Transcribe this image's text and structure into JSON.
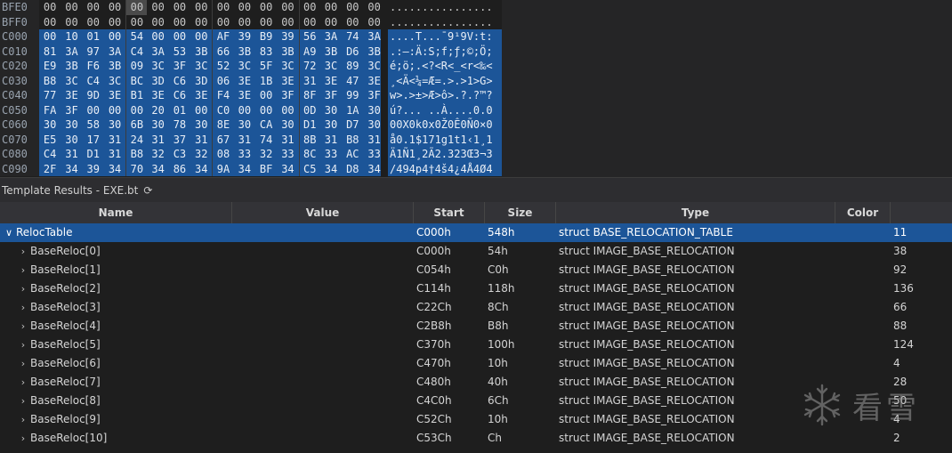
{
  "hex": {
    "rows": [
      {
        "addr": "BFE0",
        "bytes": [
          "00",
          "00",
          "00",
          "00",
          "00",
          "00",
          "00",
          "00",
          "00",
          "00",
          "00",
          "00",
          "00",
          "00",
          "00",
          "00"
        ],
        "ascii": "................",
        "selected": false,
        "cursor": 4
      },
      {
        "addr": "BFF0",
        "bytes": [
          "00",
          "00",
          "00",
          "00",
          "00",
          "00",
          "00",
          "00",
          "00",
          "00",
          "00",
          "00",
          "00",
          "00",
          "00",
          "00"
        ],
        "ascii": "................",
        "selected": false,
        "cursor": -1
      },
      {
        "addr": "C000",
        "bytes": [
          "00",
          "10",
          "01",
          "00",
          "54",
          "00",
          "00",
          "00",
          "AF",
          "39",
          "B9",
          "39",
          "56",
          "3A",
          "74",
          "3A"
        ],
        "ascii": "....T...¯9¹9V:t:",
        "selected": true,
        "cursor": -1
      },
      {
        "addr": "C010",
        "bytes": [
          "81",
          "3A",
          "97",
          "3A",
          "C4",
          "3A",
          "53",
          "3B",
          "66",
          "3B",
          "83",
          "3B",
          "A9",
          "3B",
          "D6",
          "3B"
        ],
        "ascii": ".:—:Ä:S;f;ƒ;©;Ö;",
        "selected": true,
        "cursor": -1
      },
      {
        "addr": "C020",
        "bytes": [
          "E9",
          "3B",
          "F6",
          "3B",
          "09",
          "3C",
          "3F",
          "3C",
          "52",
          "3C",
          "5F",
          "3C",
          "72",
          "3C",
          "89",
          "3C"
        ],
        "ascii": "é;ö;.<?<R<_<r<‰<",
        "selected": true,
        "cursor": -1
      },
      {
        "addr": "C030",
        "bytes": [
          "B8",
          "3C",
          "C4",
          "3C",
          "BC",
          "3D",
          "C6",
          "3D",
          "06",
          "3E",
          "1B",
          "3E",
          "31",
          "3E",
          "47",
          "3E"
        ],
        "ascii": "¸<Ä<¼=Æ=.>.>1>G>",
        "selected": true,
        "cursor": -1
      },
      {
        "addr": "C040",
        "bytes": [
          "77",
          "3E",
          "9D",
          "3E",
          "B1",
          "3E",
          "C6",
          "3E",
          "F4",
          "3E",
          "00",
          "3F",
          "8F",
          "3F",
          "99",
          "3F"
        ],
        "ascii": "w>.>±>Æ>ô>.?.?™?",
        "selected": true,
        "cursor": -1
      },
      {
        "addr": "C050",
        "bytes": [
          "FA",
          "3F",
          "00",
          "00",
          "00",
          "20",
          "01",
          "00",
          "C0",
          "00",
          "00",
          "00",
          "0D",
          "30",
          "1A",
          "30"
        ],
        "ascii": "ú?... ..À....0.0",
        "selected": true,
        "cursor": -1
      },
      {
        "addr": "C060",
        "bytes": [
          "30",
          "30",
          "58",
          "30",
          "6B",
          "30",
          "78",
          "30",
          "8E",
          "30",
          "CA",
          "30",
          "D1",
          "30",
          "D7",
          "30"
        ],
        "ascii": "00X0k0x0Ž0Ê0Ñ0×0",
        "selected": true,
        "cursor": -1
      },
      {
        "addr": "C070",
        "bytes": [
          "E5",
          "30",
          "17",
          "31",
          "24",
          "31",
          "37",
          "31",
          "67",
          "31",
          "74",
          "31",
          "8B",
          "31",
          "B8",
          "31"
        ],
        "ascii": "å0.1$171g1t1‹1¸1",
        "selected": true,
        "cursor": -1
      },
      {
        "addr": "C080",
        "bytes": [
          "C4",
          "31",
          "D1",
          "31",
          "B8",
          "32",
          "C3",
          "32",
          "08",
          "33",
          "32",
          "33",
          "8C",
          "33",
          "AC",
          "33"
        ],
        "ascii": "Ä1Ñ1¸2Ã2.323Œ3¬3",
        "selected": true,
        "cursor": -1
      },
      {
        "addr": "C090",
        "bytes": [
          "2F",
          "34",
          "39",
          "34",
          "70",
          "34",
          "86",
          "34",
          "9A",
          "34",
          "BF",
          "34",
          "C5",
          "34",
          "D8",
          "34"
        ],
        "ascii": "/494p4†4š4¿4Å4Ø4",
        "selected": true,
        "cursor": -1
      }
    ]
  },
  "template_results": {
    "title": "Template Results - EXE.bt",
    "refresh_icon": "refresh-icon",
    "columns": [
      "Name",
      "Value",
      "Start",
      "Size",
      "Type",
      "Color"
    ],
    "rows": [
      {
        "name": "RelocTable",
        "value": "",
        "start": "C000h",
        "size": "548h",
        "type": "struct BASE_RELOCATION_TABLE",
        "color": "",
        "extra": "11",
        "expanded": true,
        "indent": 0,
        "selected": true
      },
      {
        "name": "BaseReloc[0]",
        "value": "",
        "start": "C000h",
        "size": "54h",
        "type": "struct IMAGE_BASE_RELOCATION",
        "color": "",
        "extra": "38",
        "expanded": false,
        "indent": 1,
        "selected": false
      },
      {
        "name": "BaseReloc[1]",
        "value": "",
        "start": "C054h",
        "size": "C0h",
        "type": "struct IMAGE_BASE_RELOCATION",
        "color": "",
        "extra": "92",
        "expanded": false,
        "indent": 1,
        "selected": false
      },
      {
        "name": "BaseReloc[2]",
        "value": "",
        "start": "C114h",
        "size": "118h",
        "type": "struct IMAGE_BASE_RELOCATION",
        "color": "",
        "extra": "136",
        "expanded": false,
        "indent": 1,
        "selected": false
      },
      {
        "name": "BaseReloc[3]",
        "value": "",
        "start": "C22Ch",
        "size": "8Ch",
        "type": "struct IMAGE_BASE_RELOCATION",
        "color": "",
        "extra": "66",
        "expanded": false,
        "indent": 1,
        "selected": false
      },
      {
        "name": "BaseReloc[4]",
        "value": "",
        "start": "C2B8h",
        "size": "B8h",
        "type": "struct IMAGE_BASE_RELOCATION",
        "color": "",
        "extra": "88",
        "expanded": false,
        "indent": 1,
        "selected": false
      },
      {
        "name": "BaseReloc[5]",
        "value": "",
        "start": "C370h",
        "size": "100h",
        "type": "struct IMAGE_BASE_RELOCATION",
        "color": "",
        "extra": "124",
        "expanded": false,
        "indent": 1,
        "selected": false
      },
      {
        "name": "BaseReloc[6]",
        "value": "",
        "start": "C470h",
        "size": "10h",
        "type": "struct IMAGE_BASE_RELOCATION",
        "color": "",
        "extra": "4",
        "expanded": false,
        "indent": 1,
        "selected": false
      },
      {
        "name": "BaseReloc[7]",
        "value": "",
        "start": "C480h",
        "size": "40h",
        "type": "struct IMAGE_BASE_RELOCATION",
        "color": "",
        "extra": "28",
        "expanded": false,
        "indent": 1,
        "selected": false
      },
      {
        "name": "BaseReloc[8]",
        "value": "",
        "start": "C4C0h",
        "size": "6Ch",
        "type": "struct IMAGE_BASE_RELOCATION",
        "color": "",
        "extra": "50",
        "expanded": false,
        "indent": 1,
        "selected": false
      },
      {
        "name": "BaseReloc[9]",
        "value": "",
        "start": "C52Ch",
        "size": "10h",
        "type": "struct IMAGE_BASE_RELOCATION",
        "color": "",
        "extra": "4",
        "expanded": false,
        "indent": 1,
        "selected": false
      },
      {
        "name": "BaseReloc[10]",
        "value": "",
        "start": "C53Ch",
        "size": "Ch",
        "type": "struct IMAGE_BASE_RELOCATION",
        "color": "",
        "extra": "2",
        "expanded": false,
        "indent": 1,
        "selected": false
      }
    ]
  },
  "watermark": {
    "text": "看雪",
    "icon": "snowflake-icon"
  },
  "colors": {
    "selection": "#1c5598",
    "background": "#1e1e1e",
    "header": "#333337"
  }
}
